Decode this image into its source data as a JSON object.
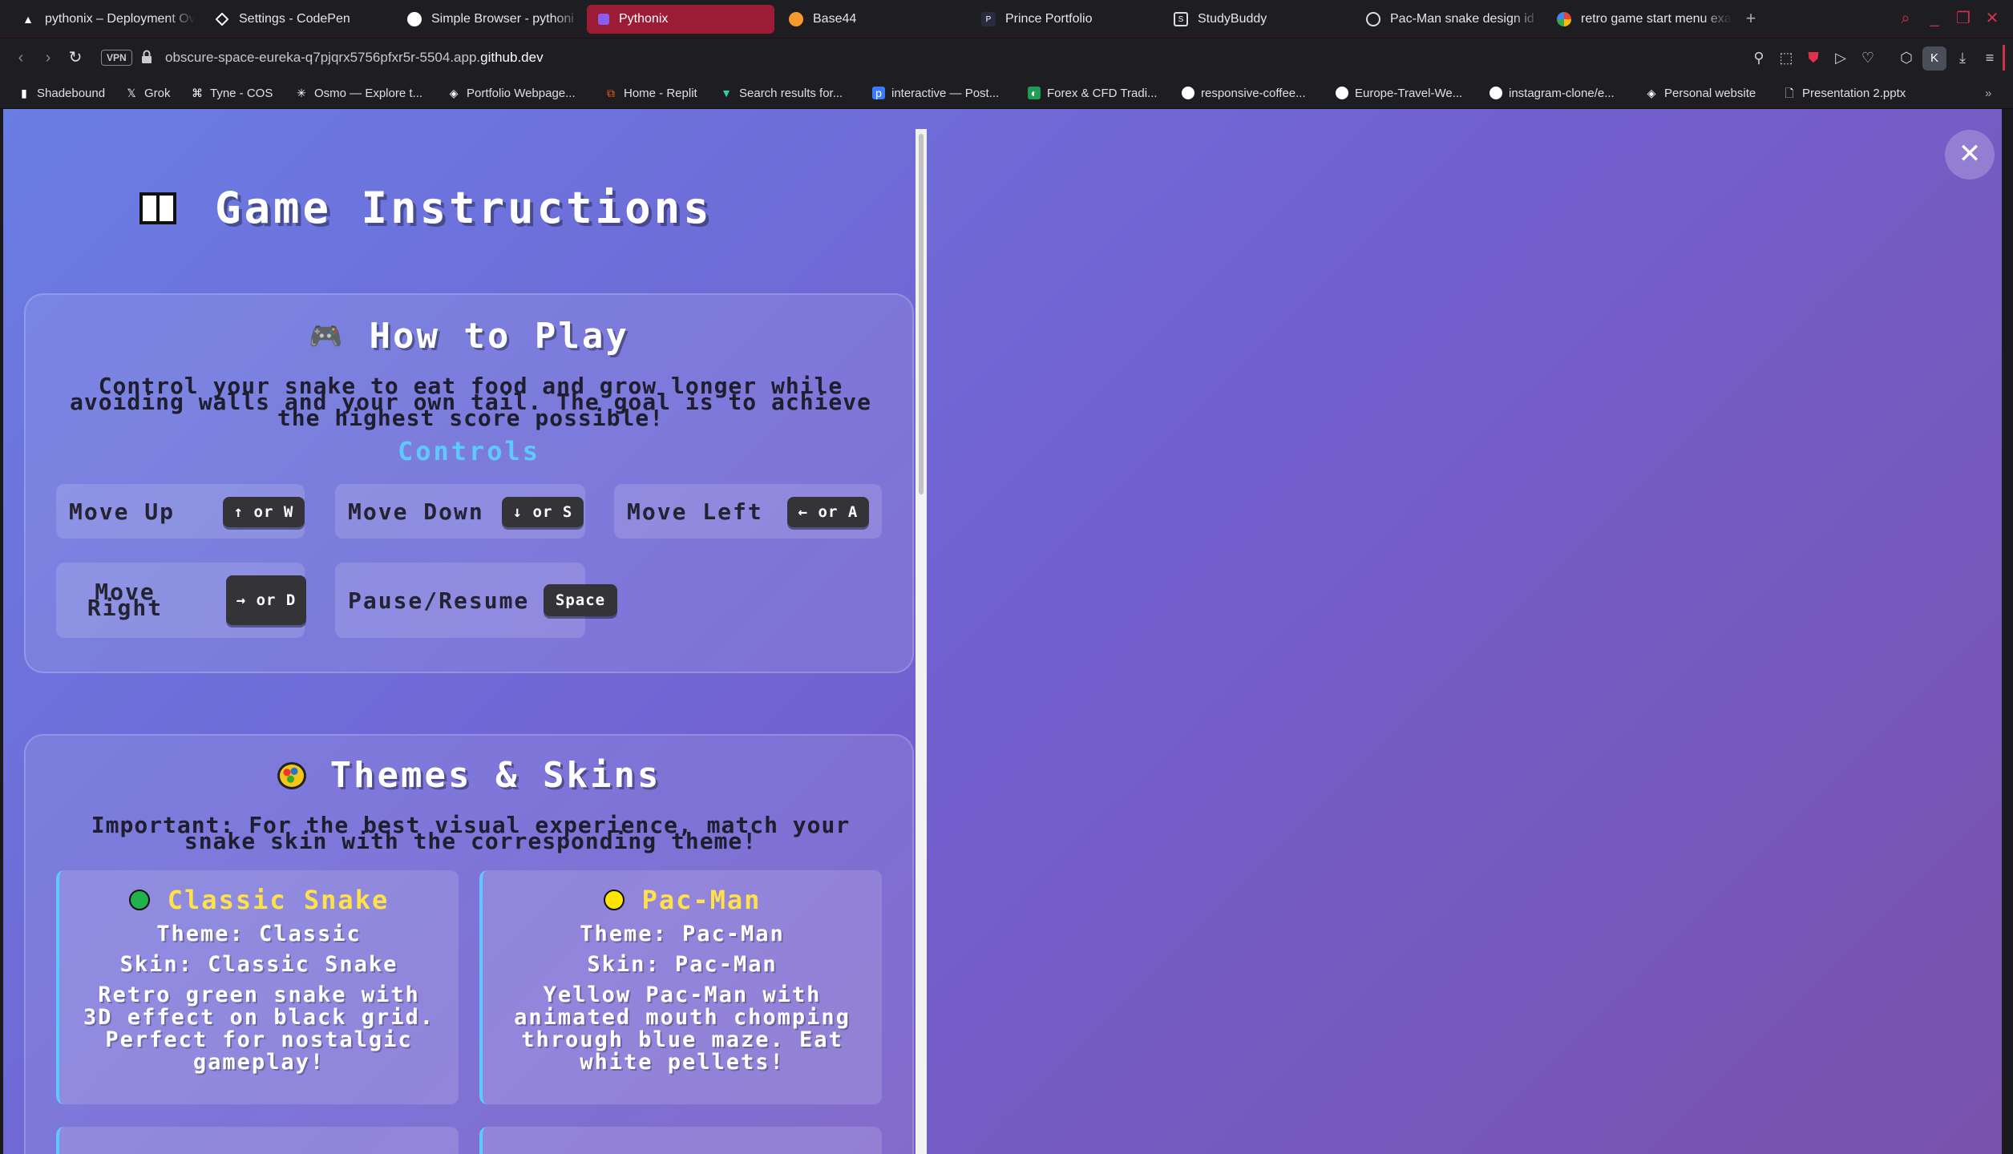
{
  "tabs": [
    {
      "title": "pythonix – Deployment Ov",
      "icon": "vercel-icon",
      "active": false
    },
    {
      "title": "Settings - CodePen",
      "icon": "codepen-icon",
      "active": false
    },
    {
      "title": "Simple Browser - pythoni",
      "icon": "github-icon",
      "active": false
    },
    {
      "title": "Pythonix",
      "icon": "pythonix-icon",
      "active": true
    },
    {
      "title": "Base44",
      "icon": "base44-icon",
      "active": false
    },
    {
      "title": "Prince Portfolio",
      "icon": "portfolio-icon",
      "active": false
    },
    {
      "title": "StudyBuddy",
      "icon": "studybuddy-icon",
      "active": false
    },
    {
      "title": "Pac-Man snake design id",
      "icon": "openai-icon",
      "active": false
    },
    {
      "title": "retro game start menu exa",
      "icon": "google-icon",
      "active": false
    }
  ],
  "address": {
    "vpn_label": "VPN",
    "url_prefix": "obscure-space-eureka-q7pjqrx5756pfxr5r-5504.app.",
    "url_domain": "github.dev"
  },
  "bookmarks": [
    {
      "label": "Shadebound",
      "icon": "shadebound-icon"
    },
    {
      "label": "Grok",
      "icon": "x-icon"
    },
    {
      "label": "Tyne - COS",
      "icon": "tyne-icon"
    },
    {
      "label": "Osmo — Explore t...",
      "icon": "osmo-icon"
    },
    {
      "label": "Portfolio Webpage...",
      "icon": "codepen-icon"
    },
    {
      "label": "Home - Replit",
      "icon": "replit-icon"
    },
    {
      "label": "Search results for...",
      "icon": "vectorized-icon"
    },
    {
      "label": "interactive — Post...",
      "icon": "postimg-icon"
    },
    {
      "label": "Forex & CFD Tradi...",
      "icon": "forex-icon"
    },
    {
      "label": "responsive-coffee...",
      "icon": "github-icon"
    },
    {
      "label": "Europe-Travel-We...",
      "icon": "github-icon"
    },
    {
      "label": "instagram-clone/e...",
      "icon": "github-icon"
    },
    {
      "label": "Personal website",
      "icon": "codepen-icon"
    },
    {
      "label": "Presentation 2.pptx",
      "icon": "file-icon"
    }
  ],
  "page": {
    "title": "Game Instructions",
    "how_to_play": {
      "heading": "How to Play",
      "description": "Control your snake to eat food and grow longer while avoiding walls and your own tail. The goal is to achieve the highest score possible!",
      "controls_heading": "Controls",
      "controls": [
        {
          "action": "Move Up",
          "key": "↑ or W"
        },
        {
          "action": "Move Down",
          "key": "↓ or S"
        },
        {
          "action": "Move Left",
          "key": "← or A"
        },
        {
          "action": "Move Right",
          "key": "→ or D"
        },
        {
          "action": "Pause/Resume",
          "key": "Space"
        }
      ]
    },
    "themes": {
      "heading": "Themes & Skins",
      "note": "Important: For the best visual experience, match your snake skin with the corresponding theme!",
      "cards": [
        {
          "name": "Classic Snake",
          "dot_color": "#22b24c",
          "theme": "Theme: Classic",
          "skin": "Skin: Classic Snake",
          "description": "Retro green snake with 3D effect on black grid. Perfect for nostalgic gameplay!"
        },
        {
          "name": "Pac-Man",
          "dot_color": "#ffe600",
          "theme": "Theme: Pac-Man",
          "skin": "Skin: Pac-Man",
          "description": "Yellow Pac-Man with animated mouth chomping through blue maze. Eat white pellets!"
        }
      ]
    }
  }
}
